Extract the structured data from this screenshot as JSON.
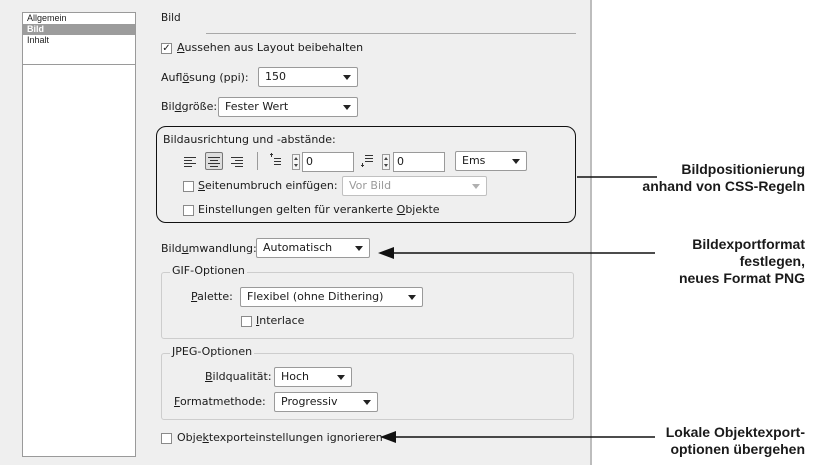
{
  "sidebar": {
    "items": [
      {
        "label": "Allgemein",
        "selected": false
      },
      {
        "label": "Bild",
        "selected": true
      },
      {
        "label": "Inhalt",
        "selected": false
      }
    ]
  },
  "section": {
    "title": "Bild"
  },
  "keep_appearance": {
    "checked": true,
    "accel": "A",
    "rest": "ussehen aus Layout beibehalten"
  },
  "resolution": {
    "label_pre": "Aufl",
    "label_accel": "ö",
    "label_post": "sung (ppi):",
    "value": "150"
  },
  "image_size": {
    "label_pre": "Bil",
    "label_accel": "d",
    "label_post": "größe:",
    "value": "Fester Wert"
  },
  "alignment": {
    "label": "Bildausrichtung und -abstände:",
    "space_before": "0",
    "space_after": "0",
    "unit": "Ems",
    "page_break": {
      "checked": false,
      "accel": "S",
      "rest": "eitenumbruch einfügen:",
      "value": "Vor Bild"
    },
    "anchored": {
      "checked": false,
      "pre": "Einstellungen gelten für verankerte ",
      "accel": "O",
      "post": "bjekte"
    }
  },
  "conversion": {
    "label_pre": "Bild",
    "label_accel": "u",
    "label_post": "mwandlung:",
    "value": "Automatisch"
  },
  "gif": {
    "title": "GIF-Optionen",
    "palette_accel": "P",
    "palette_rest": "alette:",
    "palette_value": "Flexibel (ohne Dithering)",
    "interlace": {
      "checked": false,
      "accel": "I",
      "rest": "nterlace"
    }
  },
  "jpeg": {
    "title": "JPEG-Optionen",
    "quality_accel": "B",
    "quality_rest": "ildqualität:",
    "quality_value": "Hoch",
    "method_accel": "F",
    "method_rest": "ormatmethode:",
    "method_value": "Progressiv"
  },
  "ignore_object": {
    "checked": false,
    "pre": "Obje",
    "accel": "k",
    "post": "texporteinstellungen ignorieren"
  },
  "callouts": [
    {
      "lines": [
        "Bildpositionierung",
        "anhand von CSS-Regeln"
      ]
    },
    {
      "lines": [
        "Bildexportformat",
        "festlegen,",
        "neues Format PNG"
      ]
    },
    {
      "lines": [
        "Lokale Objektexport-",
        "optionen übergehen"
      ]
    }
  ]
}
